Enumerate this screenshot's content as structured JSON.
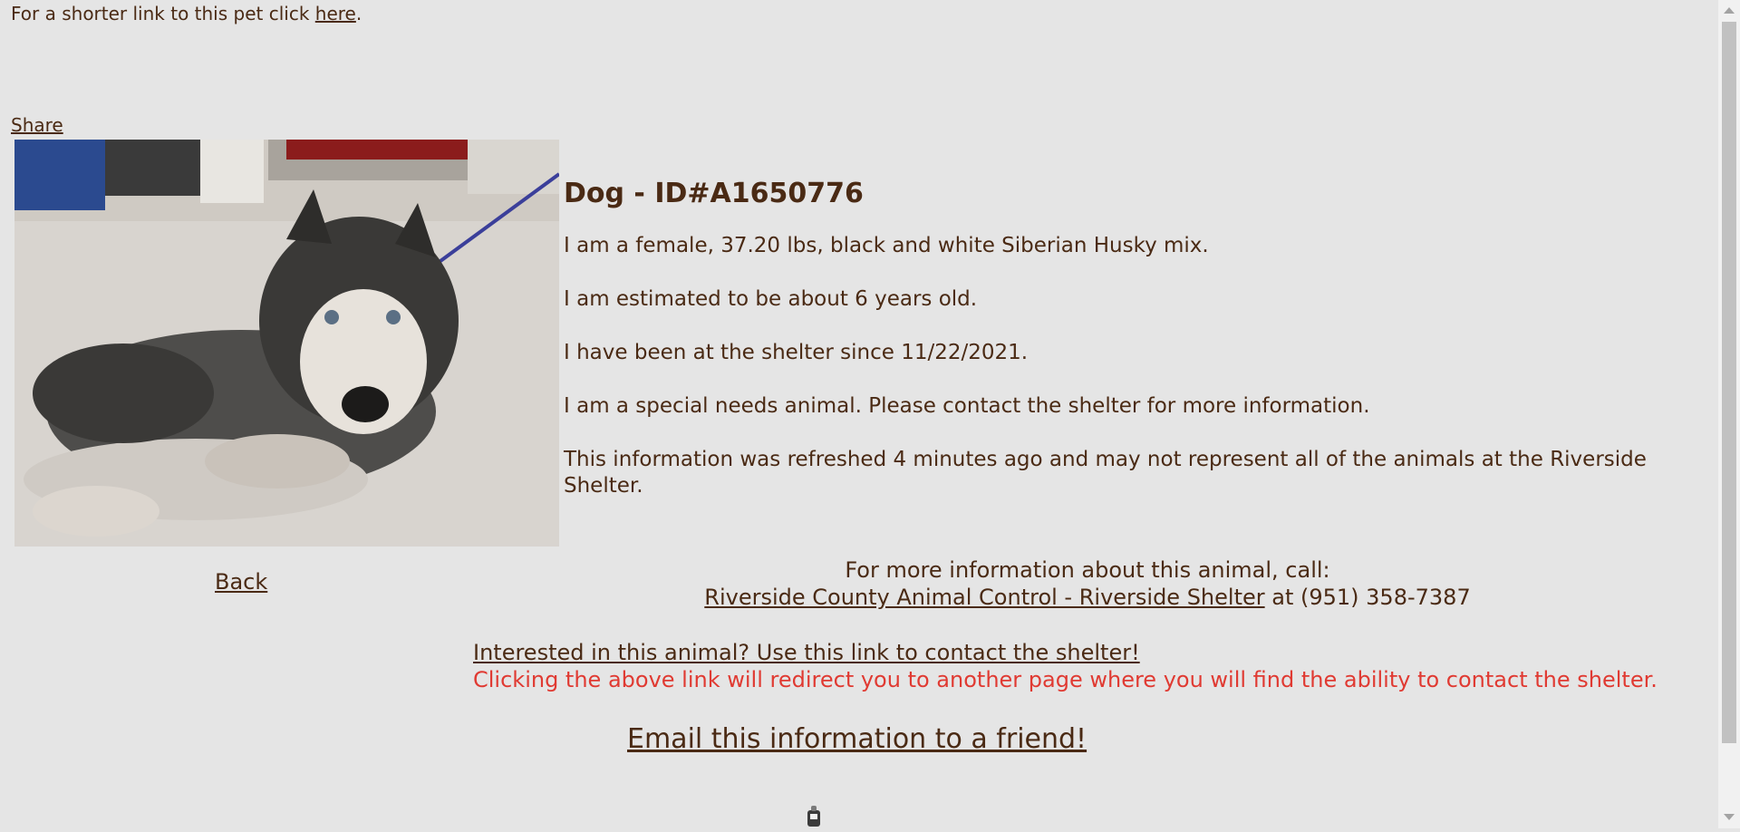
{
  "top": {
    "shortlink_prefix": "For a shorter link to this pet click ",
    "shortlink_link": "here",
    "shortlink_suffix": "."
  },
  "share_label": "Share",
  "animal": {
    "title": "Dog - ID#A1650776",
    "description": "I am a female, 37.20 lbs, black and white Siberian Husky mix.",
    "age": "I am estimated to be about 6 years old.",
    "since": "I have been at the shelter since 11/22/2021.",
    "special_needs": "I am a special needs animal. Please contact the shelter for more information.",
    "refresh_note": "This information was refreshed 4 minutes ago and may not represent all of the animals at the Riverside Shelter."
  },
  "back_label": "Back",
  "call": {
    "line1": "For more information about this animal, call:",
    "shelter_link": "Riverside County Animal Control - Riverside Shelter",
    "phone_text": " at (951) 358-7387"
  },
  "contact": {
    "link": "Interested in this animal? Use this link to contact the shelter!",
    "note": "Clicking the above link will redirect you to another page where you will find the ability to contact the shelter."
  },
  "email_label": "Email this information to a friend!",
  "colors": {
    "background": "#e5e5e5",
    "text": "#4a2a14",
    "warning": "#e03a32"
  }
}
